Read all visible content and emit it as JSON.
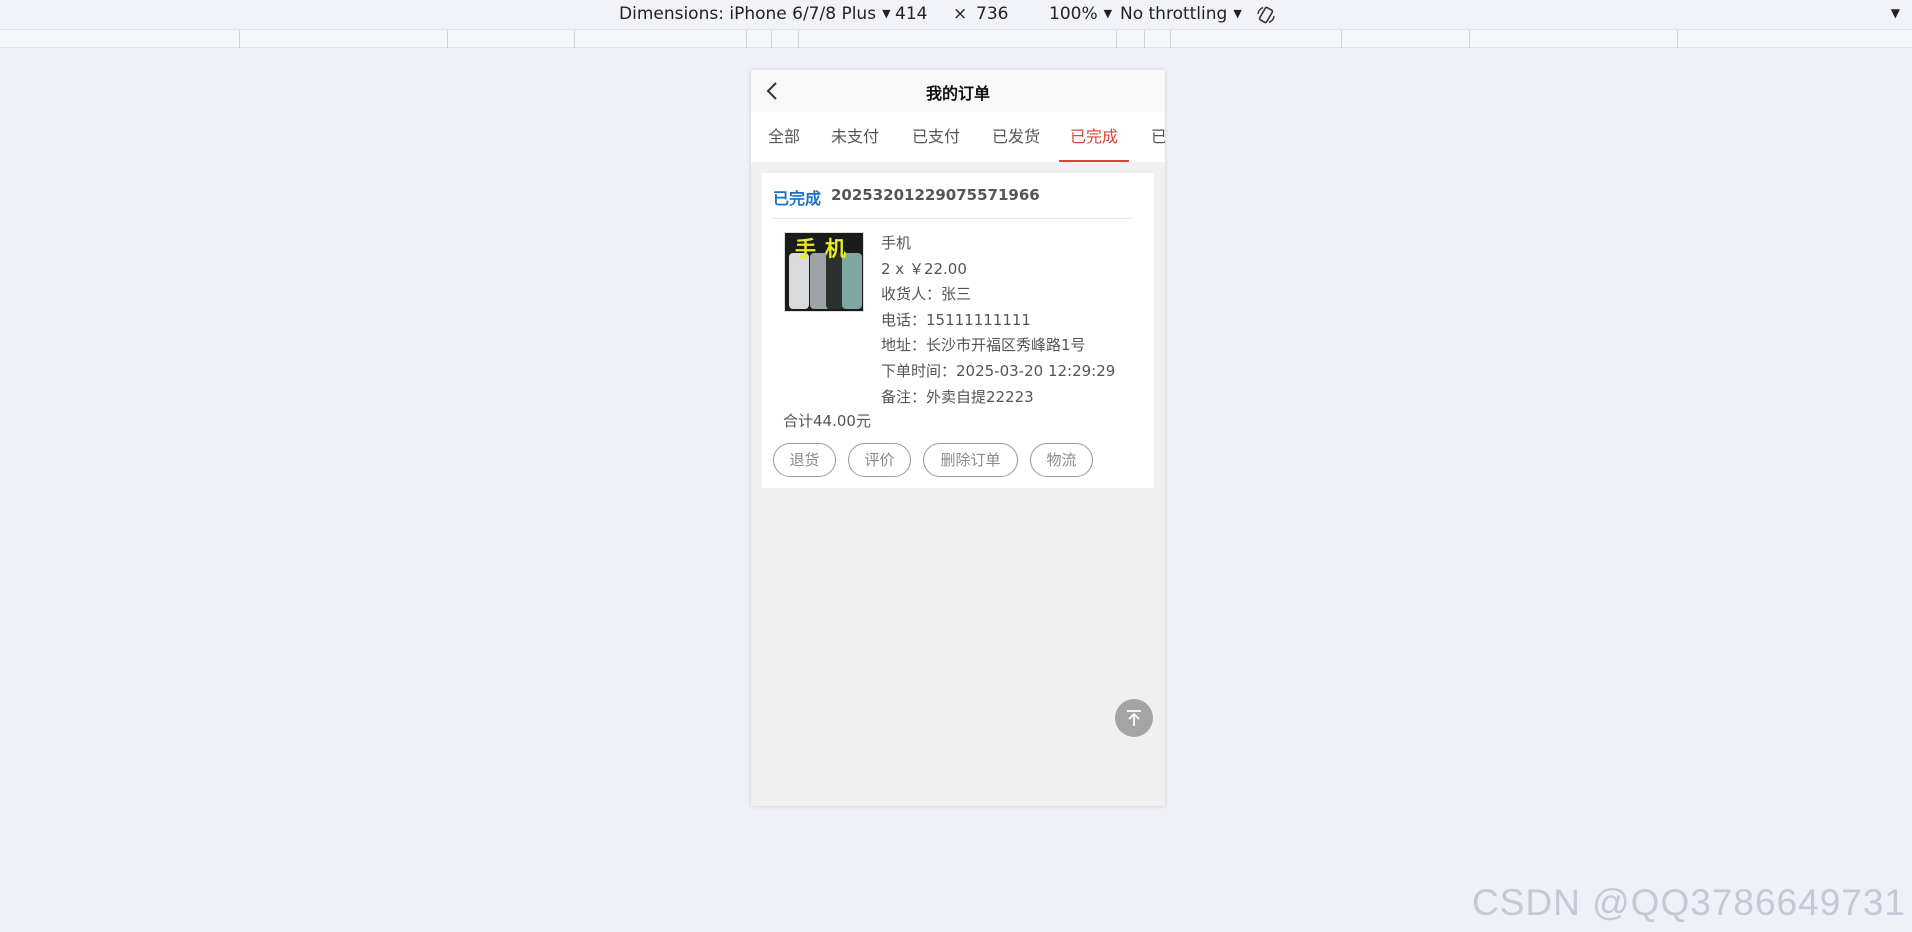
{
  "devtools": {
    "dimensions_label": "Dimensions: iPhone 6/7/8 Plus",
    "width": "414",
    "times": "×",
    "height": "736",
    "zoom": "100%",
    "throttling": "No throttling"
  },
  "nav": {
    "title": "我的订单",
    "back_icon": "chevron-left-icon"
  },
  "tabs": [
    {
      "label": "全部",
      "active": false
    },
    {
      "label": "未支付",
      "active": false
    },
    {
      "label": "已支付",
      "active": false
    },
    {
      "label": "已发货",
      "active": false
    },
    {
      "label": "已完成",
      "active": true
    },
    {
      "label": "已",
      "active": false
    }
  ],
  "order": {
    "status": "已完成",
    "order_no": "20253201229075571966",
    "product": {
      "image_text": "手机",
      "name": "手机",
      "qty_price": "2 x ￥22.00"
    },
    "receiver": "收货人：张三",
    "phone": "电话：15111111111",
    "address": "地址：长沙市开福区秀峰路1号",
    "order_time": "下单时间：2025-03-20 12:29:29",
    "remark": "备注：外卖自提22223",
    "total": "合计44.00元",
    "actions": [
      "退货",
      "评价",
      "删除订单",
      "物流"
    ]
  },
  "back_to_top_icon": "arrow-up-to-top-icon",
  "watermark": "CSDN @QQ3786649731",
  "colors": {
    "active_tab": "#d9463b",
    "status_blue": "#1772c9"
  }
}
